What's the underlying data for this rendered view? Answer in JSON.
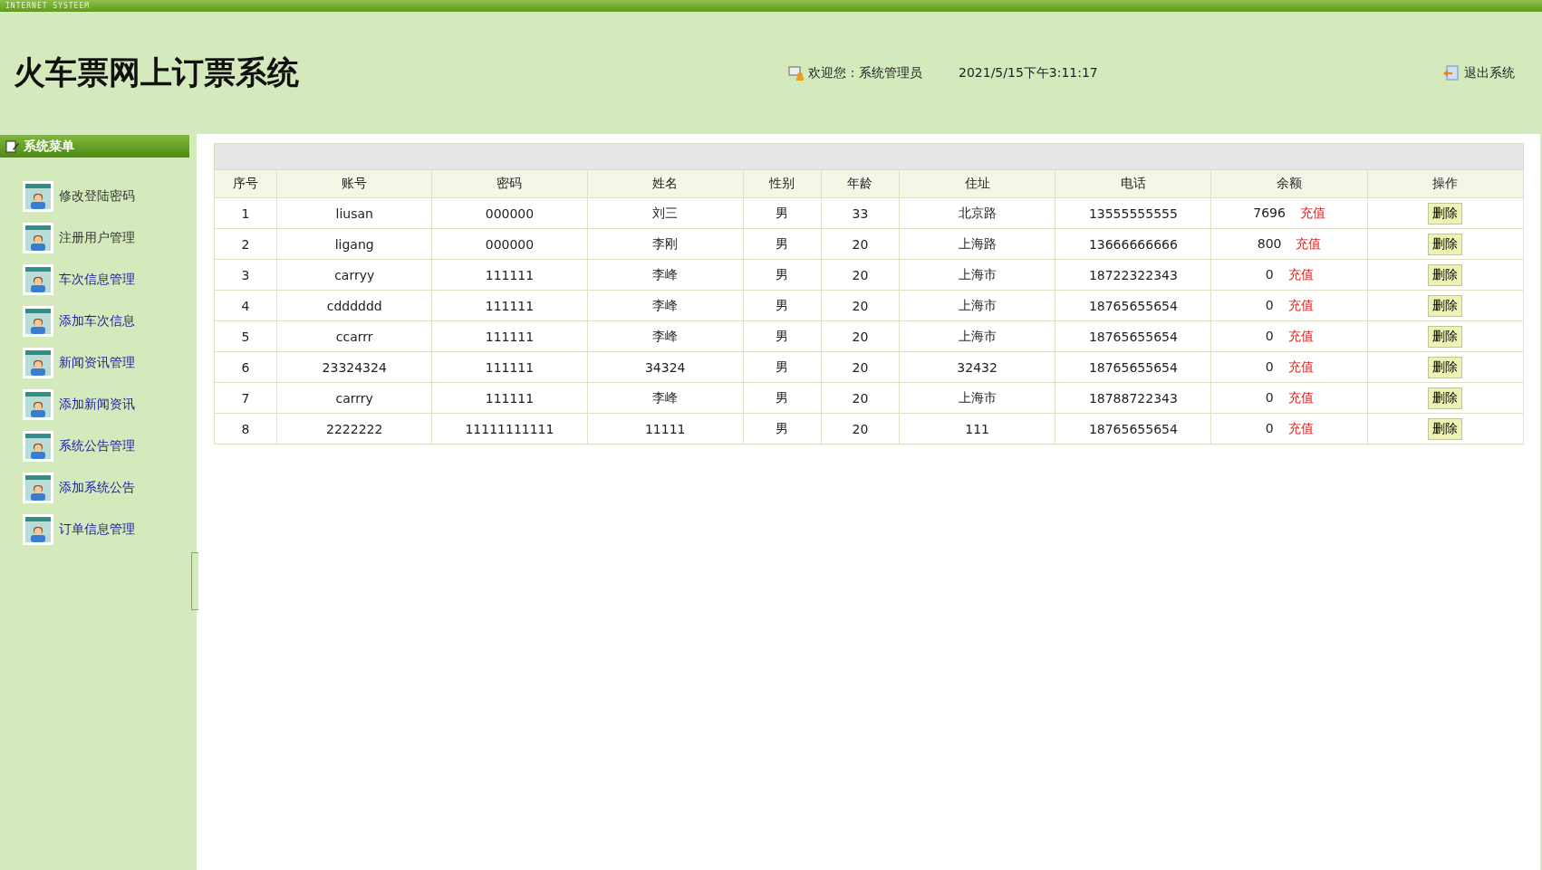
{
  "top_bar": {
    "label": "INTERNET SYSTEEM"
  },
  "header": {
    "title": "火车票网上订票系统",
    "welcome": "欢迎您：系统管理员",
    "datetime": "2021/5/15下午3:11:17",
    "logout": "退出系统"
  },
  "sidebar": {
    "title": "系统菜单",
    "items": [
      {
        "label": "修改登陆密码",
        "visited": true
      },
      {
        "label": "注册用户管理",
        "visited": true
      },
      {
        "label": "车次信息管理",
        "visited": false
      },
      {
        "label": "添加车次信息",
        "visited": false
      },
      {
        "label": "新闻资讯管理",
        "visited": false
      },
      {
        "label": "添加新闻资讯",
        "visited": false
      },
      {
        "label": "系统公告管理",
        "visited": false
      },
      {
        "label": "添加系统公告",
        "visited": false
      },
      {
        "label": "订单信息管理",
        "visited": false
      }
    ]
  },
  "table": {
    "columns": [
      "序号",
      "账号",
      "密码",
      "姓名",
      "性别",
      "年龄",
      "住址",
      "电话",
      "余额",
      "操作"
    ],
    "rows": [
      {
        "no": "1",
        "account": "liusan",
        "password": "000000",
        "name": "刘三",
        "gender": "男",
        "age": "33",
        "address": "北京路",
        "phone": "13555555555",
        "balance": "7696",
        "recharge": "充值",
        "delete": "删除"
      },
      {
        "no": "2",
        "account": "ligang",
        "password": "000000",
        "name": "李刚",
        "gender": "男",
        "age": "20",
        "address": "上海路",
        "phone": "13666666666",
        "balance": "800",
        "recharge": "充值",
        "delete": "删除"
      },
      {
        "no": "3",
        "account": "carryy",
        "password": "111111",
        "name": "李峰",
        "gender": "男",
        "age": "20",
        "address": "上海市",
        "phone": "18722322343",
        "balance": "0",
        "recharge": "充值",
        "delete": "删除"
      },
      {
        "no": "4",
        "account": "cdddddd",
        "password": "111111",
        "name": "李峰",
        "gender": "男",
        "age": "20",
        "address": "上海市",
        "phone": "18765655654",
        "balance": "0",
        "recharge": "充值",
        "delete": "删除"
      },
      {
        "no": "5",
        "account": "ccarrr",
        "password": "111111",
        "name": "李峰",
        "gender": "男",
        "age": "20",
        "address": "上海市",
        "phone": "18765655654",
        "balance": "0",
        "recharge": "充值",
        "delete": "删除"
      },
      {
        "no": "6",
        "account": "23324324",
        "password": "111111",
        "name": "34324",
        "gender": "男",
        "age": "20",
        "address": "32432",
        "phone": "18765655654",
        "balance": "0",
        "recharge": "充值",
        "delete": "删除"
      },
      {
        "no": "7",
        "account": "carrry",
        "password": "111111",
        "name": "李峰",
        "gender": "男",
        "age": "20",
        "address": "上海市",
        "phone": "18788722343",
        "balance": "0",
        "recharge": "充值",
        "delete": "删除"
      },
      {
        "no": "8",
        "account": "2222222",
        "password": "11111111111",
        "name": "11111",
        "gender": "男",
        "age": "20",
        "address": "111",
        "phone": "18765655654",
        "balance": "0",
        "recharge": "充值",
        "delete": "删除"
      }
    ]
  }
}
